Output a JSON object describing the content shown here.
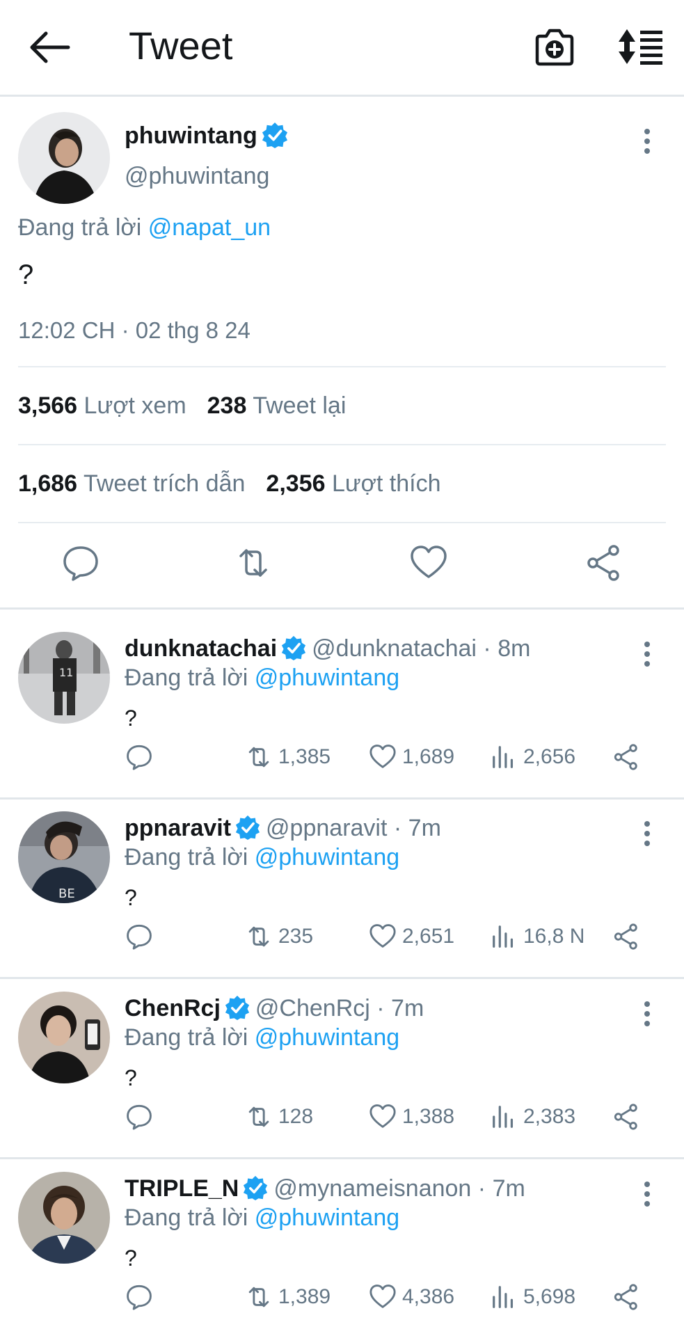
{
  "header": {
    "title": "Tweet"
  },
  "tweet": {
    "name": "phuwintang",
    "handle": "@phuwintang",
    "reply_prefix": "Đang trả lời",
    "reply_to": "@napat_un",
    "text": "?",
    "timestamp": "12:02 CH · 02 thg 8 24",
    "views_count": "3,566",
    "views_label": "Lượt xem",
    "retweets_count": "238",
    "retweets_label": "Tweet lại",
    "quotes_count": "1,686",
    "quotes_label": "Tweet trích dẫn",
    "likes_count": "2,356",
    "likes_label": "Lượt thích"
  },
  "replies": [
    {
      "name": "dunknatachai",
      "handle": "@dunknatachai",
      "time": "8m",
      "reply_prefix": "Đang trả lời",
      "reply_to": "@phuwintang",
      "text": "?",
      "retweets": "1,385",
      "likes": "1,689",
      "views": "2,656"
    },
    {
      "name": "ppnaravit",
      "handle": "@ppnaravit",
      "time": "7m",
      "reply_prefix": "Đang trả lời",
      "reply_to": "@phuwintang",
      "text": "?",
      "retweets": "235",
      "likes": "2,651",
      "views": "16,8 N"
    },
    {
      "name": "ChenRcj",
      "handle": "@ChenRcj",
      "time": "7m",
      "reply_prefix": "Đang trả lời",
      "reply_to": "@phuwintang",
      "text": "?",
      "retweets": "128",
      "likes": "1,388",
      "views": "2,383"
    },
    {
      "name": "TRIPLE_N",
      "handle": "@mynameisnanon",
      "time": "7m",
      "reply_prefix": "Đang trả lời",
      "reply_to": "@phuwintang",
      "text": "?",
      "retweets": "1,389",
      "likes": "4,386",
      "views": "5,698"
    }
  ],
  "colors": {
    "accent": "#1da1f2",
    "muted": "#657786",
    "text": "#14171a",
    "divider": "#e1e6ea"
  },
  "icons": [
    "back-arrow-icon",
    "camera-plus-icon",
    "sort-icon",
    "verified-badge-icon",
    "more-vertical-icon",
    "reply-icon",
    "retweet-icon",
    "like-icon",
    "share-icon",
    "views-icon"
  ]
}
